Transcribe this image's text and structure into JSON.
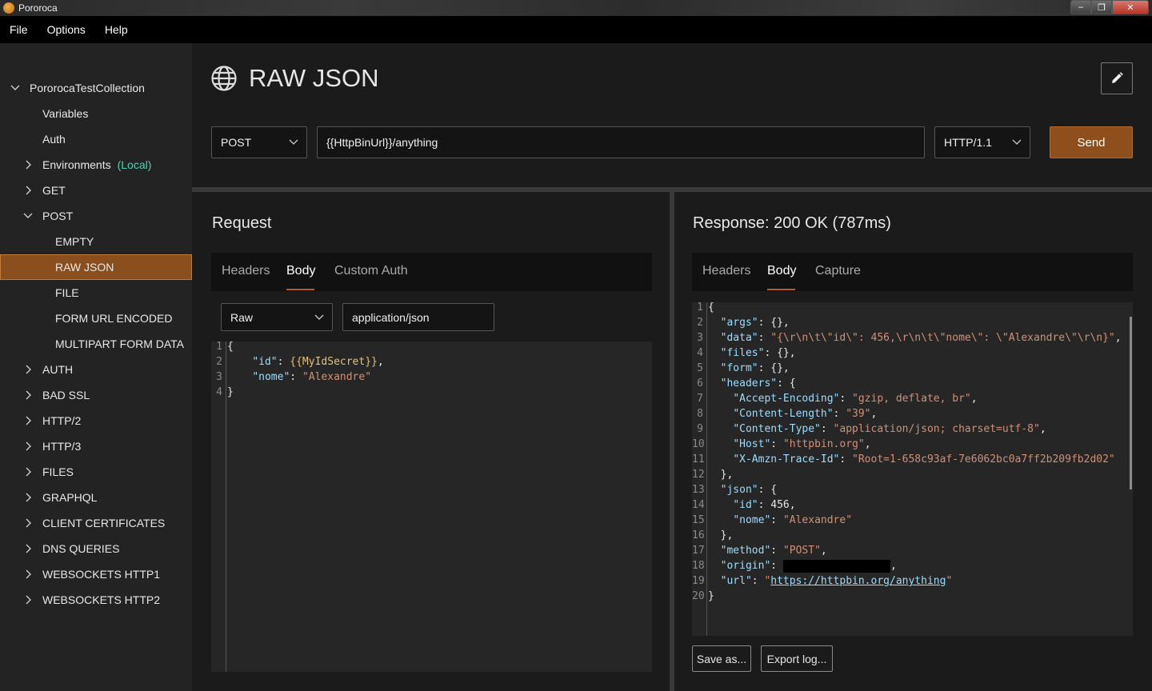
{
  "window": {
    "title": "Pororoca",
    "min": "–",
    "max": "❐",
    "close": "✕"
  },
  "menu": [
    "File",
    "Options",
    "Help"
  ],
  "sidebar": {
    "collection": "PororocaTestCollection",
    "variables": "Variables",
    "auth": "Auth",
    "environments": "Environments",
    "environments_tag": "(Local)",
    "get": "GET",
    "post": "POST",
    "post_children": [
      "EMPTY",
      "RAW JSON",
      "FILE",
      "FORM URL ENCODED",
      "MULTIPART FORM DATA"
    ],
    "folders": [
      "AUTH",
      "BAD SSL",
      "HTTP/2",
      "HTTP/3",
      "FILES",
      "GRAPHQL",
      "CLIENT CERTIFICATES",
      "DNS QUERIES",
      "WEBSOCKETS HTTP1",
      "WEBSOCKETS HTTP2"
    ]
  },
  "request_header": {
    "title": "RAW JSON",
    "method": "POST",
    "url": "{{HttpBinUrl}}/anything",
    "http_version": "HTTP/1.1",
    "send_label": "Send"
  },
  "request": {
    "title": "Request",
    "tabs": [
      "Headers",
      "Body",
      "Custom Auth"
    ],
    "active_tab": "Body",
    "body_mode": "Raw",
    "content_type": "application/json",
    "body_lines": [
      [
        [
          "p",
          "{"
        ]
      ],
      [
        [
          "p",
          "    "
        ],
        [
          "k",
          "\"id\""
        ],
        [
          "p",
          ": "
        ],
        [
          "v",
          "{{MyIdSecret}}"
        ],
        [
          "p",
          ","
        ]
      ],
      [
        [
          "p",
          "    "
        ],
        [
          "k",
          "\"nome\""
        ],
        [
          "p",
          ": "
        ],
        [
          "s",
          "\"Alexandre\""
        ]
      ],
      [
        [
          "p",
          "}"
        ]
      ]
    ]
  },
  "response": {
    "title": "Response: 200 OK (787ms)",
    "tabs": [
      "Headers",
      "Body",
      "Capture"
    ],
    "active_tab": "Body",
    "body_lines": [
      [
        [
          "p",
          "{"
        ]
      ],
      [
        [
          "p",
          "  "
        ],
        [
          "k",
          "\"args\""
        ],
        [
          "p",
          ": {},"
        ]
      ],
      [
        [
          "p",
          "  "
        ],
        [
          "k",
          "\"data\""
        ],
        [
          "p",
          ": "
        ],
        [
          "s",
          "\"{\\r\\n\\t\\\"id\\\": 456,\\r\\n\\t\\\"nome\\\": \\\"Alexandre\\\"\\r\\n}\""
        ],
        [
          "p",
          ","
        ]
      ],
      [
        [
          "p",
          "  "
        ],
        [
          "k",
          "\"files\""
        ],
        [
          "p",
          ": {},"
        ]
      ],
      [
        [
          "p",
          "  "
        ],
        [
          "k",
          "\"form\""
        ],
        [
          "p",
          ": {},"
        ]
      ],
      [
        [
          "p",
          "  "
        ],
        [
          "k",
          "\"headers\""
        ],
        [
          "p",
          ": {"
        ]
      ],
      [
        [
          "p",
          "    "
        ],
        [
          "k",
          "\"Accept-Encoding\""
        ],
        [
          "p",
          ": "
        ],
        [
          "s",
          "\"gzip, deflate, br\""
        ],
        [
          "p",
          ","
        ]
      ],
      [
        [
          "p",
          "    "
        ],
        [
          "k",
          "\"Content-Length\""
        ],
        [
          "p",
          ": "
        ],
        [
          "s",
          "\"39\""
        ],
        [
          "p",
          ","
        ]
      ],
      [
        [
          "p",
          "    "
        ],
        [
          "k",
          "\"Content-Type\""
        ],
        [
          "p",
          ": "
        ],
        [
          "s",
          "\"application/json; charset=utf-8\""
        ],
        [
          "p",
          ","
        ]
      ],
      [
        [
          "p",
          "    "
        ],
        [
          "k",
          "\"Host\""
        ],
        [
          "p",
          ": "
        ],
        [
          "s",
          "\"httpbin.org\""
        ],
        [
          "p",
          ","
        ]
      ],
      [
        [
          "p",
          "    "
        ],
        [
          "k",
          "\"X-Amzn-Trace-Id\""
        ],
        [
          "p",
          ": "
        ],
        [
          "s",
          "\"Root=1-658c93af-7e6062bc0a7ff2b209fb2d02\""
        ]
      ],
      [
        [
          "p",
          "  },"
        ]
      ],
      [
        [
          "p",
          "  "
        ],
        [
          "k",
          "\"json\""
        ],
        [
          "p",
          ": {"
        ]
      ],
      [
        [
          "p",
          "    "
        ],
        [
          "k",
          "\"id\""
        ],
        [
          "p",
          ": 456,"
        ]
      ],
      [
        [
          "p",
          "    "
        ],
        [
          "k",
          "\"nome\""
        ],
        [
          "p",
          ": "
        ],
        [
          "s",
          "\"Alexandre\""
        ]
      ],
      [
        [
          "p",
          "  },"
        ]
      ],
      [
        [
          "p",
          "  "
        ],
        [
          "k",
          "\"method\""
        ],
        [
          "p",
          ": "
        ],
        [
          "s",
          "\"POST\""
        ],
        [
          "p",
          ","
        ]
      ],
      [
        [
          "p",
          "  "
        ],
        [
          "k",
          "\"origin\""
        ],
        [
          "p",
          ": "
        ],
        [
          "r",
          ""
        ],
        [
          "p",
          ","
        ]
      ],
      [
        [
          "p",
          "  "
        ],
        [
          "k",
          "\"url\""
        ],
        [
          "p",
          ": "
        ],
        [
          "s",
          "\""
        ],
        [
          "u",
          "https://httpbin.org/anything"
        ],
        [
          "s",
          "\""
        ]
      ],
      [
        [
          "p",
          "}"
        ]
      ]
    ],
    "save_label": "Save as...",
    "export_label": "Export log..."
  },
  "colors": {
    "accent": "#8e4f1c",
    "selected": "#8a4f1c",
    "local": "#4fd3b0"
  }
}
